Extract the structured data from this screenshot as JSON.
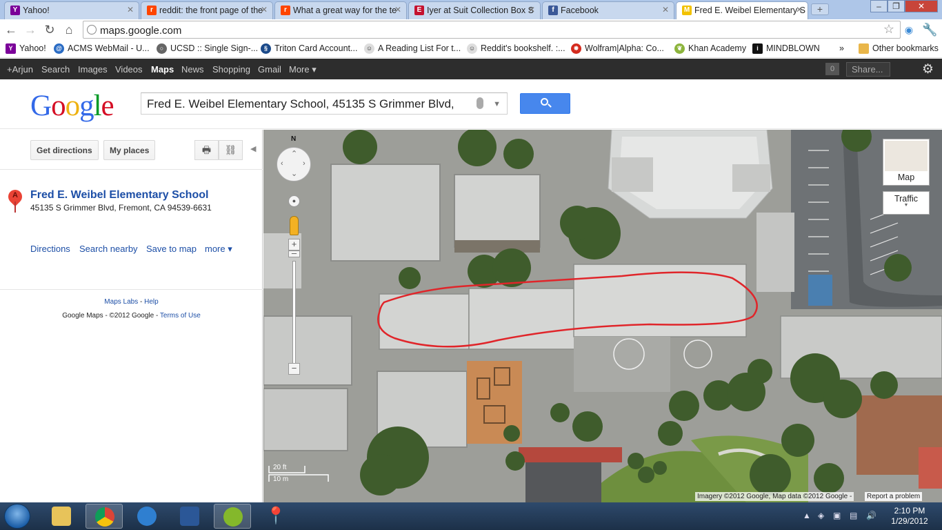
{
  "browser": {
    "tabs": [
      {
        "title": "Yahoo!",
        "icon": "yahoo-icon",
        "color": "#7b0099"
      },
      {
        "title": "reddit: the front page of the",
        "icon": "reddit-icon",
        "color": "#ff4500"
      },
      {
        "title": "What a great way for the te",
        "icon": "reddit-icon",
        "color": "#ff4500"
      },
      {
        "title": "Iyer at Suit Collection Box S",
        "icon": "espn-icon",
        "color": "#c4122f"
      },
      {
        "title": "Facebook",
        "icon": "facebook-icon",
        "color": "#3b5998"
      },
      {
        "title": "Fred E. Weibel Elementary S",
        "icon": "google-maps-icon",
        "color": "#f2c200"
      }
    ],
    "url": "maps.google.com",
    "bookmarks": [
      "Yahoo!",
      "ACMS WebMail - U...",
      "UCSD :: Single Sign-...",
      "Triton Card Account...",
      "A Reading List For t...",
      "Reddit's bookshelf. :...",
      "Wolfram|Alpha: Co...",
      "Khan Academy",
      "MINDBLOWN"
    ],
    "other_bookmarks": "Other bookmarks"
  },
  "gbar": {
    "items": [
      "+Arjun",
      "Search",
      "Images",
      "Videos",
      "Maps",
      "News",
      "Shopping",
      "Gmail",
      "More ▾"
    ],
    "count": "0",
    "share": "Share..."
  },
  "search": {
    "logo": "Google",
    "query": "Fred E. Weibel Elementary School, 45135 S Grimmer Blvd,"
  },
  "panel": {
    "get_directions": "Get directions",
    "my_places": "My places",
    "marker": "A",
    "result_name": "Fred E. Weibel Elementary School",
    "result_address": "45135 S Grimmer Blvd, Fremont, CA 94539-6631",
    "actions": [
      "Directions",
      "Search nearby",
      "Save to map",
      "more ▾"
    ],
    "maps_labs": "Maps Labs",
    "help": "Help",
    "copyright": "Google Maps - ©2012 Google - ",
    "terms": "Terms of Use"
  },
  "map": {
    "north": "N",
    "type_button": "Map",
    "traffic_button": "Traffic",
    "scale_ft": "20 ft",
    "scale_m": "10 m",
    "credit": "Imagery ©2012 Google, Map data ©2012 Google -",
    "report": "Report a problem"
  },
  "taskbar": {
    "time": "2:10 PM",
    "date": "1/29/2012"
  }
}
